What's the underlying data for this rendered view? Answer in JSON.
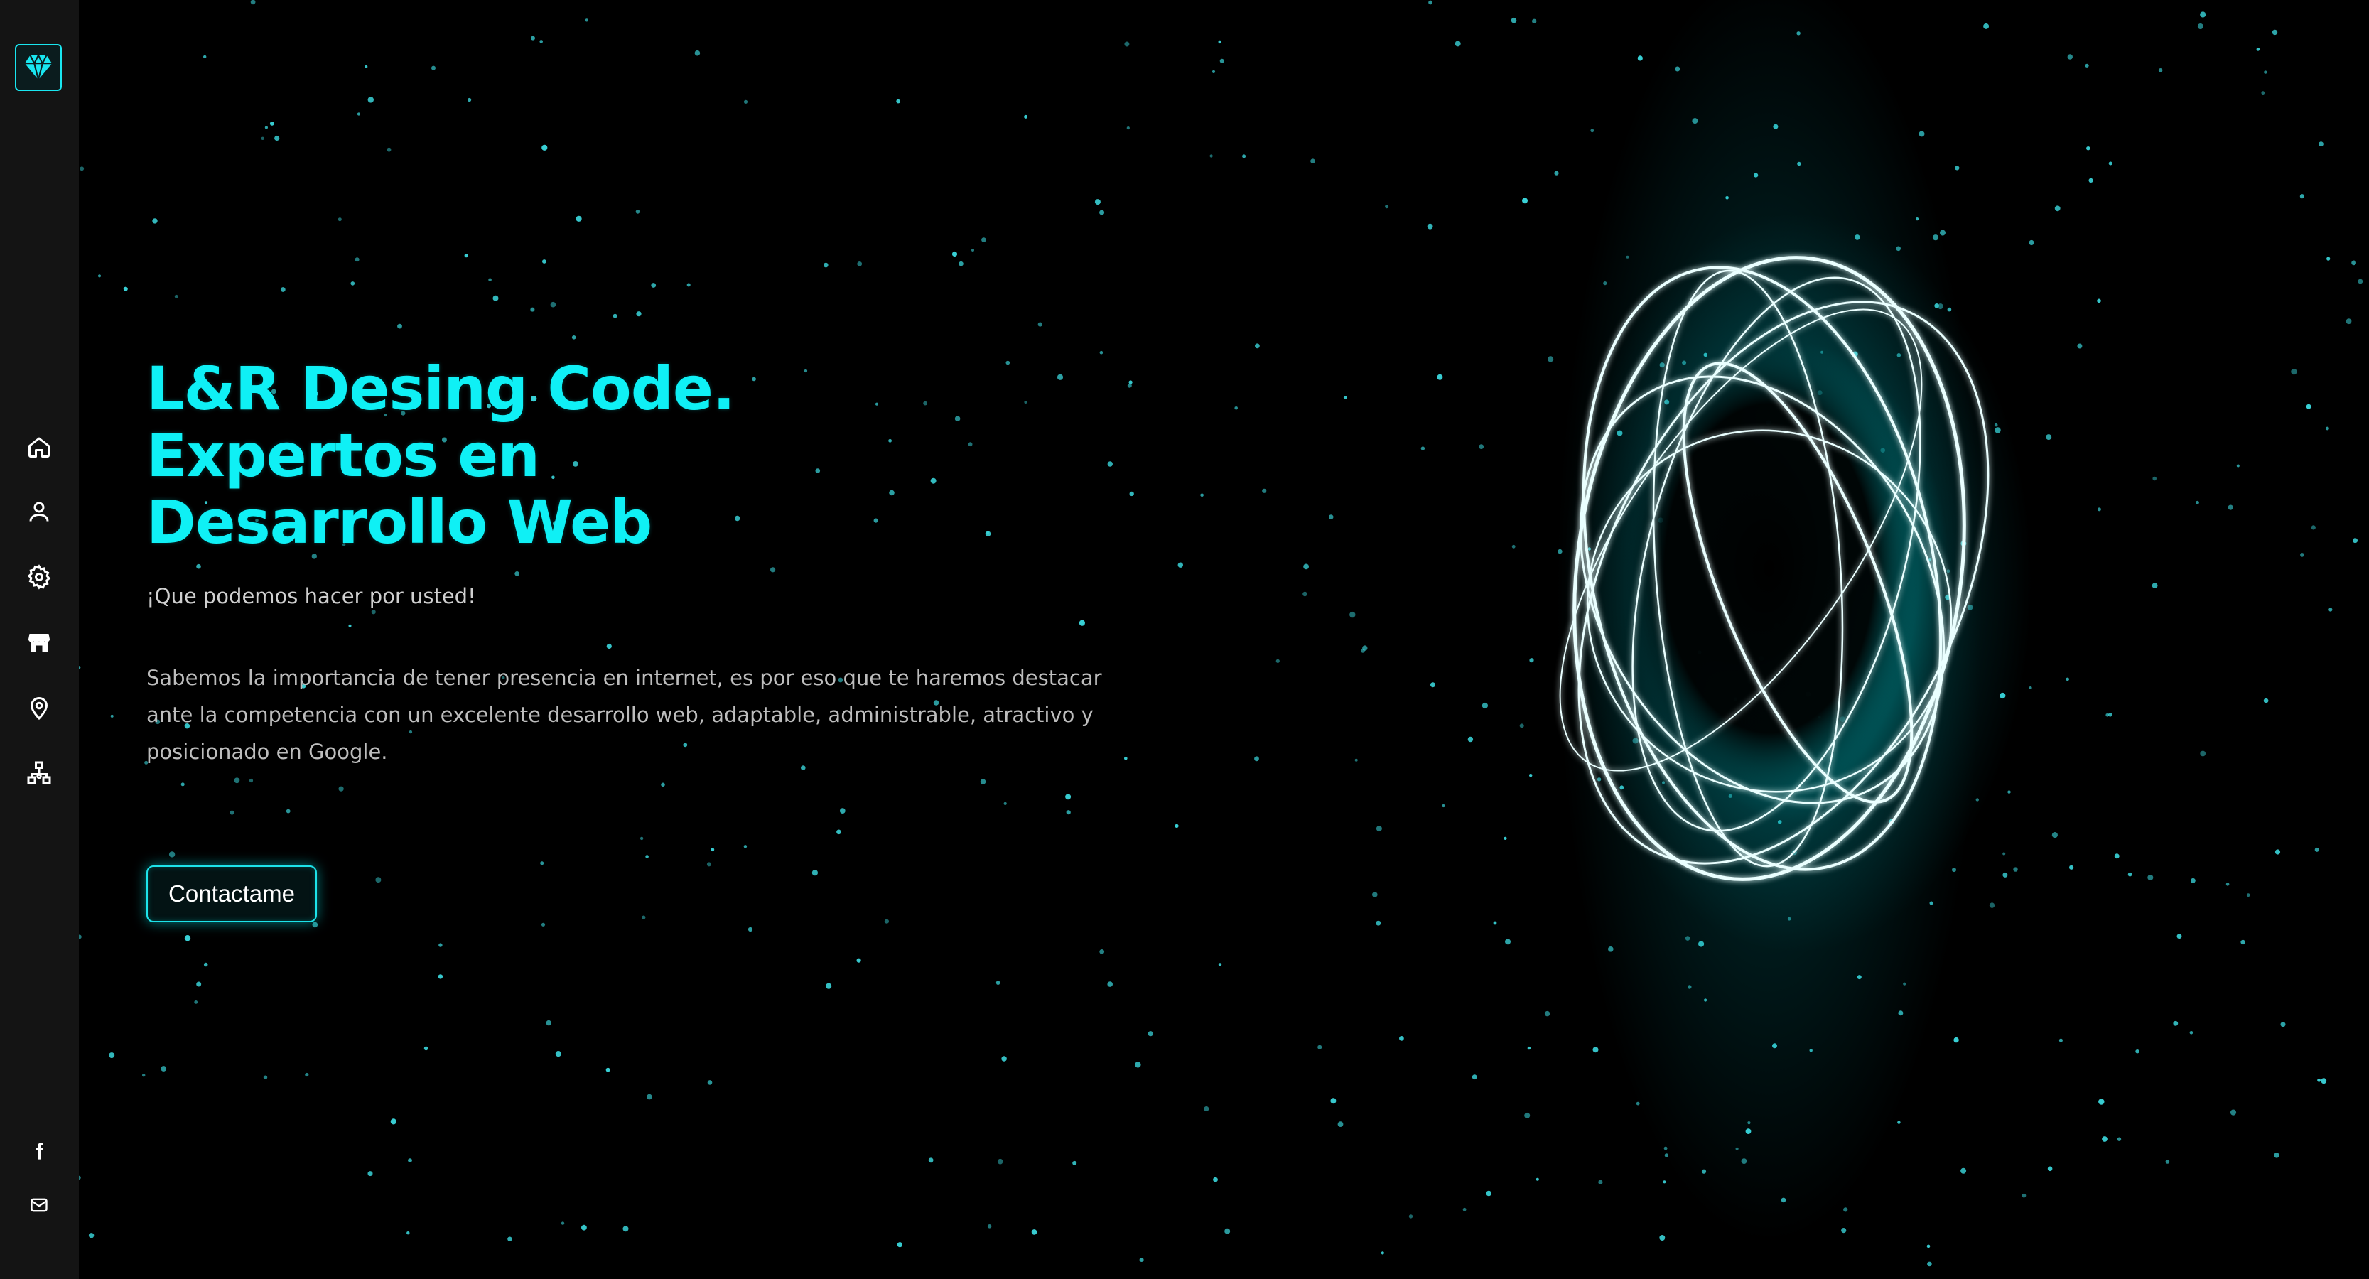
{
  "hero": {
    "title_line1": "L&R Desing Code.",
    "title_line2": "Expertos en",
    "title_line3": "Desarrollo Web",
    "subtitle": "¡Que podemos hacer por usted!",
    "description": "Sabemos la importancia de tener presencia en internet, es por eso que te haremos destacar ante la competencia con un excelente desarrollo web, adaptable, administrable, atractivo y posicionado en Google.",
    "cta_label": "Contactame"
  },
  "sidebar": {
    "logo_icon": "diamond-icon",
    "nav_items": [
      {
        "icon": "home-icon"
      },
      {
        "icon": "user-icon"
      },
      {
        "icon": "gear-icon"
      },
      {
        "icon": "store-icon"
      },
      {
        "icon": "location-pin-icon"
      },
      {
        "icon": "network-icon"
      }
    ],
    "social_items": [
      {
        "icon": "facebook-icon"
      },
      {
        "icon": "mail-icon"
      }
    ]
  },
  "colors": {
    "accent": "#00f0f5",
    "background": "#000000",
    "sidebar": "#141414",
    "text": "#bdbdbd"
  }
}
